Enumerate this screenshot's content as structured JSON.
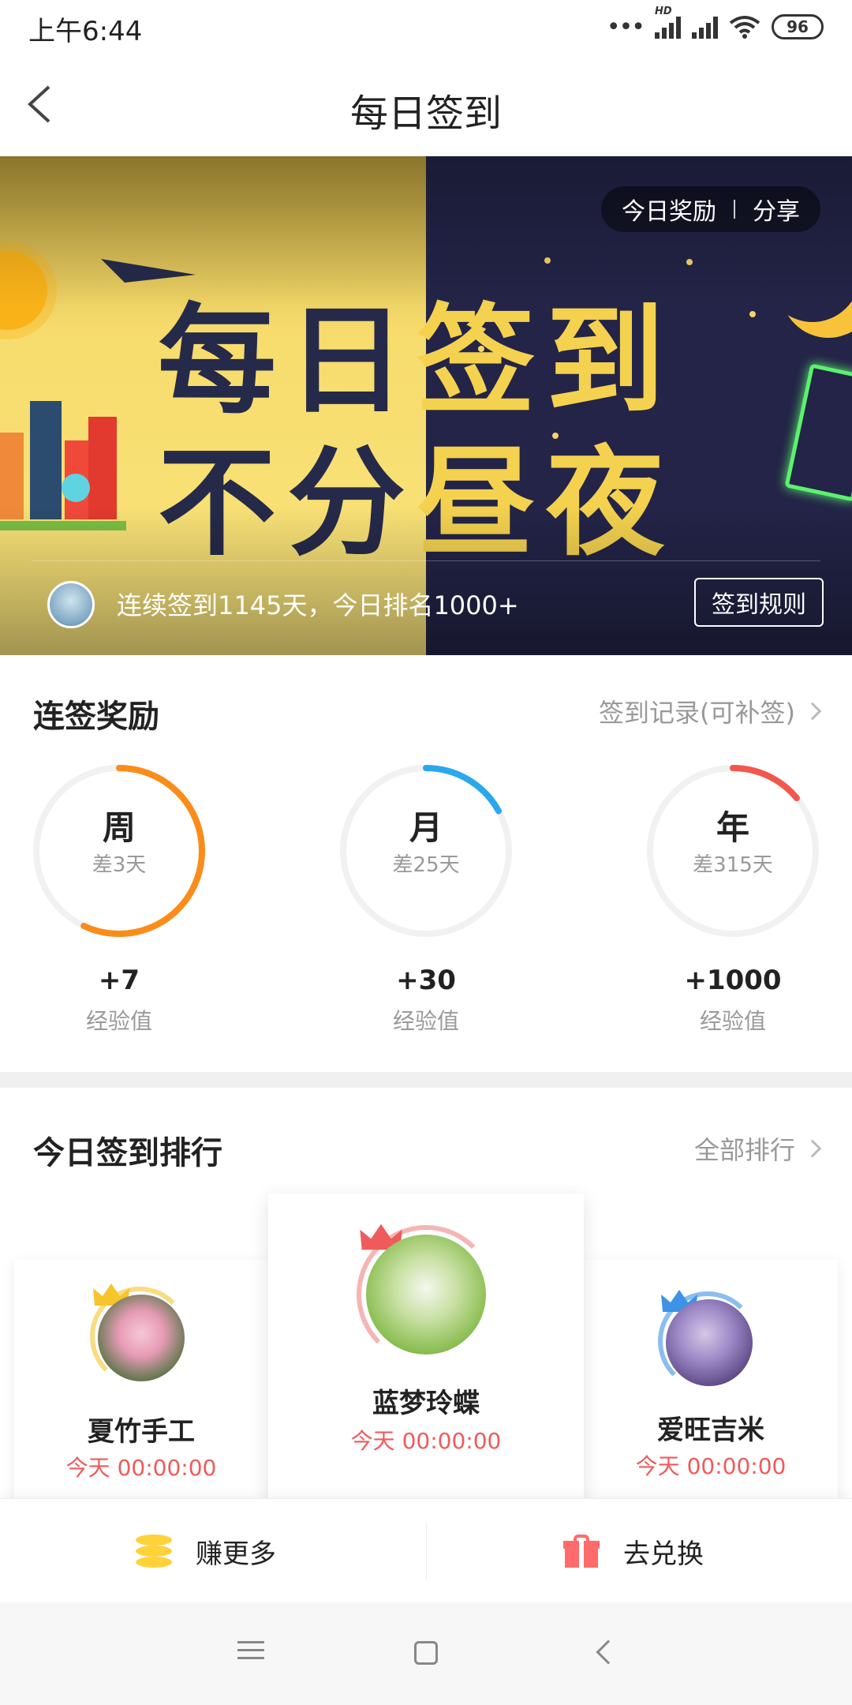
{
  "status_bar": {
    "time": "上午6:44",
    "battery": "96"
  },
  "header": {
    "title": "每日签到"
  },
  "banner": {
    "headline_line1": [
      "每",
      "日",
      "签",
      "到"
    ],
    "headline_line2": [
      "不",
      "分",
      "昼",
      "夜"
    ],
    "pill_reward": "今日奖励",
    "pill_share": "分享",
    "streak_text": "连续签到1145天，今日排名1000+",
    "rules_button": "签到规则"
  },
  "streak_rewards": {
    "title": "连签奖励",
    "record_link": "签到记录(可补签)",
    "items": [
      {
        "label": "周",
        "remaining": "差3天",
        "reward": "+7",
        "unit": "经验值",
        "progress": 0.57,
        "color": "#fb8c1a"
      },
      {
        "label": "月",
        "remaining": "差25天",
        "reward": "+30",
        "unit": "经验值",
        "progress": 0.17,
        "color": "#2aa8ec"
      },
      {
        "label": "年",
        "remaining": "差315天",
        "reward": "+1000",
        "unit": "经验值",
        "progress": 0.14,
        "color": "#f2574e"
      }
    ]
  },
  "ranking": {
    "title": "今日签到排行",
    "all_link": "全部排行",
    "entries": [
      {
        "rank": 2,
        "name": "夏竹手工",
        "time": "今天 00:00:00",
        "crown_color": "#f6c52c"
      },
      {
        "rank": 1,
        "name": "蓝梦玲蝶",
        "time": "今天 00:00:00",
        "crown_color": "#ef5b5b"
      },
      {
        "rank": 3,
        "name": "爱旺吉米",
        "time": "今天 00:00:00",
        "crown_color": "#3d93e6"
      }
    ]
  },
  "actions": {
    "earn_more": "赚更多",
    "redeem": "去兑换"
  }
}
